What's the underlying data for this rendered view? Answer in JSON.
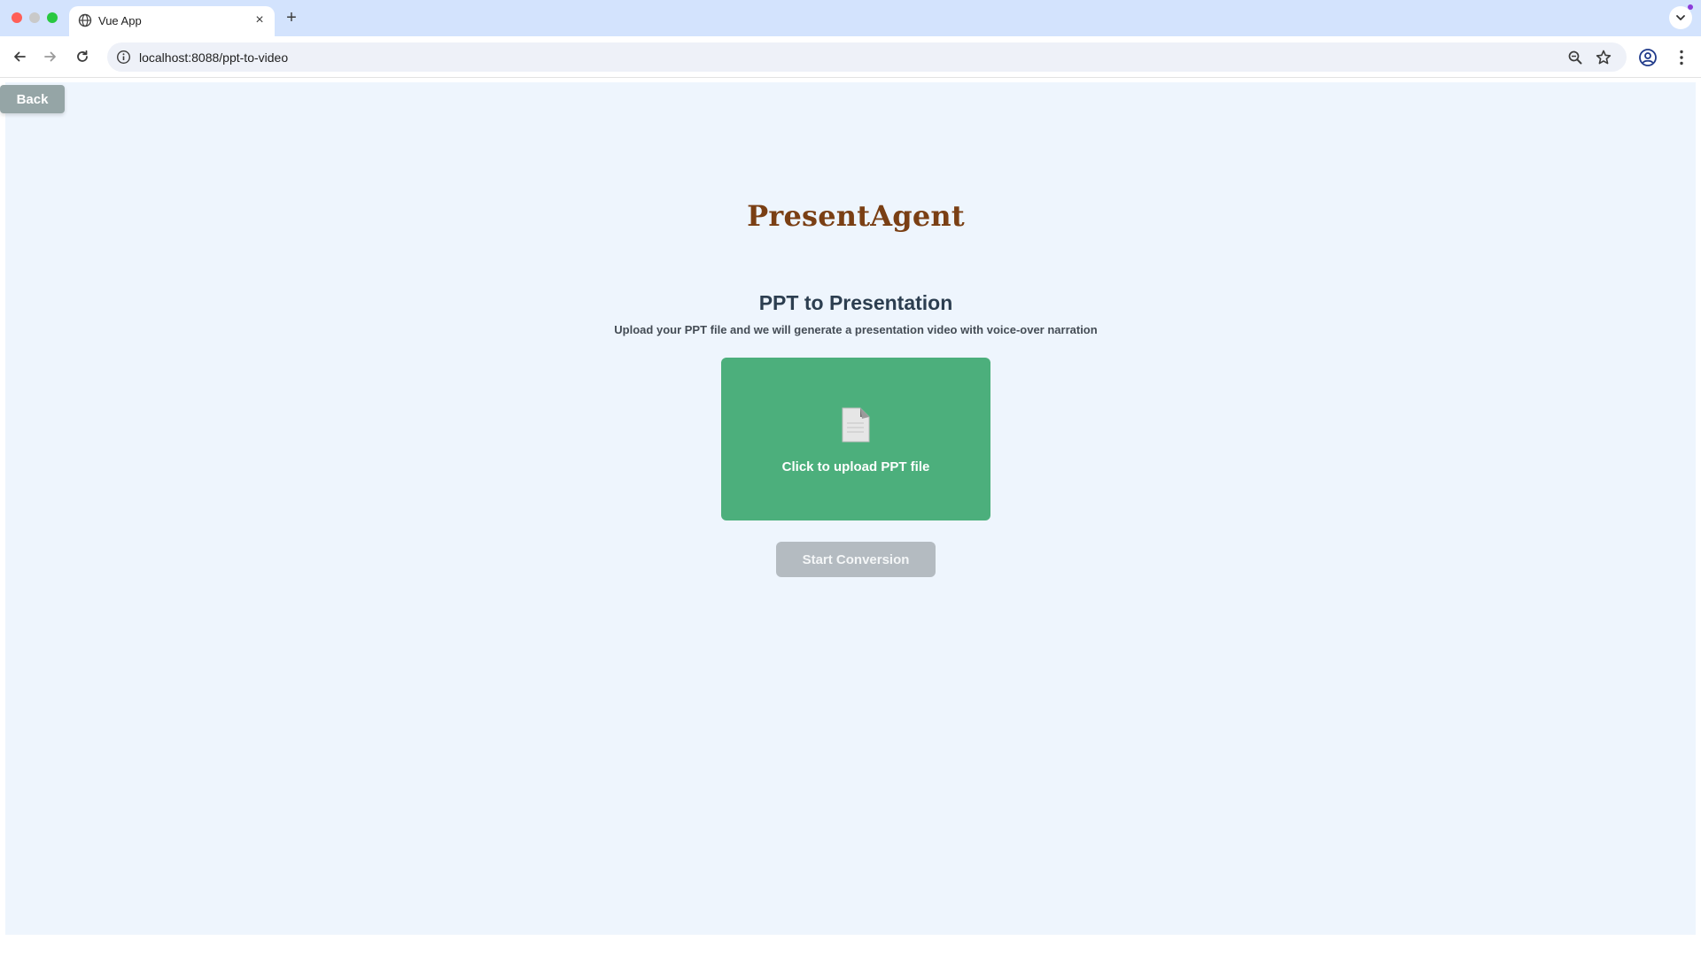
{
  "browser": {
    "tab_title": "Vue App",
    "tab_close": "×",
    "new_tab": "+",
    "url": "localhost:8088/ppt-to-video"
  },
  "page": {
    "back_label": "Back",
    "brand": "PresentAgent",
    "title": "PPT to Presentation",
    "subtitle": "Upload your PPT file and we will generate a presentation video with voice-over narration",
    "upload_label": "Click to upload PPT file",
    "start_label": "Start Conversion"
  },
  "icons": {
    "tab": "globe-icon",
    "nav": [
      "back-arrow-icon",
      "forward-arrow-icon",
      "reload-icon"
    ],
    "omnibox": [
      "site-info-icon",
      "zoom-icon",
      "star-icon"
    ],
    "toolbar_right": [
      "profile-icon",
      "kebab-menu-icon"
    ],
    "upload": "file-icon"
  },
  "colors": {
    "chrome_tabbar": "#d3e3fd",
    "page_background": "#eef5fd",
    "brand_text": "#7a3f14",
    "title_text": "#2c3e50",
    "upload_zone": "#4caf7c",
    "back_button": "#95a5a6",
    "start_button_disabled": "#b4bbc1"
  }
}
